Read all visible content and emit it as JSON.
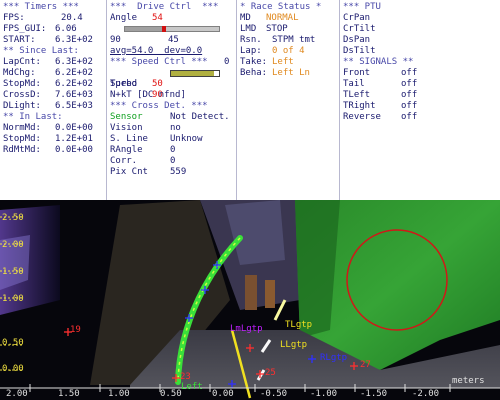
{
  "timers": {
    "header": "*** Timers ***",
    "fps_label": "FPS:",
    "fps": "20.4",
    "fps_gui_label": "FPS_GUI:",
    "fps_gui": "6.06",
    "start_label": "START:",
    "start": "6.3E+02",
    "since_last_header": "** Since Last:",
    "lapcnt_label": "LapCnt:",
    "lapcnt": "6.3E+02",
    "mdchg_label": "MdChg:",
    "mdchg": "6.2E+02",
    "stopmd_label": "StopMd:",
    "stopmd": "6.2E+02",
    "crossd_label": "CrossD:",
    "crossd": "7.6E+03",
    "dlight_label": "DLight:",
    "dlight": "6.5E+03",
    "in_last_header": "** In Last:",
    "normmd_label": "NormMd:",
    "normmd": "0.0E+00",
    "stopmd2_label": "StopMd:",
    "stopmd2": "1.2E+01",
    "rdmtmd_label": "RdMtMd:",
    "rdmtmd": "0.0E+00"
  },
  "drive": {
    "header": "***  Drive Ctrl  ***",
    "angle_label": "Angle",
    "angle": "54",
    "angle_left": "90",
    "angle_right": "0",
    "angle_center": "45",
    "angle_fraction": 0.4,
    "avg_dev": "avg=54.0  dev=0.0",
    "speed_header": "*** Speed Ctrl ***",
    "speed_label": "Speed",
    "speed": "90",
    "speed_fraction": 0.9,
    "turbo_label": "Turbo",
    "turbo": "50",
    "mode": "N+kT [DC nfnd]",
    "cross_header": "*** Cross Det. ***",
    "sensor_label": "Sensor",
    "sensor": "Not Detect.",
    "vision_label": "Vision",
    "vision": "no",
    "sline_label": "S. Line",
    "sline": "Unknow",
    "rangle_label": "RAngle",
    "rangle": "0",
    "corr_label": "Corr.",
    "corr": "0",
    "pixcnt_label": "Pix Cnt",
    "pixcnt": "559"
  },
  "race": {
    "header": "* Race Status *",
    "md_label": "MD",
    "md": "NORMAL",
    "lmd_label": "LMD",
    "lmd": "STOP",
    "rsn_label": "Rsn.",
    "rsn": "STPM tmt",
    "lap_label": "Lap:",
    "lap": "0 of 4",
    "take_label": "Take:",
    "take": "Left",
    "beha_label": "Beha:",
    "beha": "Left Ln"
  },
  "ptu": {
    "header": "*** PTU",
    "items": [
      "CrPan",
      "CrTilt",
      "DsPan",
      "DsTilt"
    ],
    "signals_header": "** SIGNALS **",
    "signals": [
      {
        "label": "Front",
        "value": "off"
      },
      {
        "label": "Tail",
        "value": "off"
      },
      {
        "label": "TLeft",
        "value": "off"
      },
      {
        "label": "TRight",
        "value": "off"
      },
      {
        "label": "Reverse",
        "value": "off"
      }
    ]
  },
  "view": {
    "y_ticks": [
      "2.50",
      "2.00",
      "1.50",
      "1.00",
      "0.50",
      "0.00"
    ],
    "x_ticks": [
      "2.00",
      "1.50",
      "1.00",
      "0.50",
      "0.00",
      "-0.50",
      "-1.00",
      "-1.50",
      "-2.00"
    ],
    "x_unit": "meters",
    "tag_left": "Left",
    "tag_23": "23",
    "tag_25": "25",
    "tag_19": "19",
    "tag_27": "27",
    "tag_tlgtp": "TLgtp",
    "tag_llgtp": "LLgtp",
    "tag_lmlgtp": "LmLgtp",
    "tag_rlgtp": "RLgtp"
  }
}
